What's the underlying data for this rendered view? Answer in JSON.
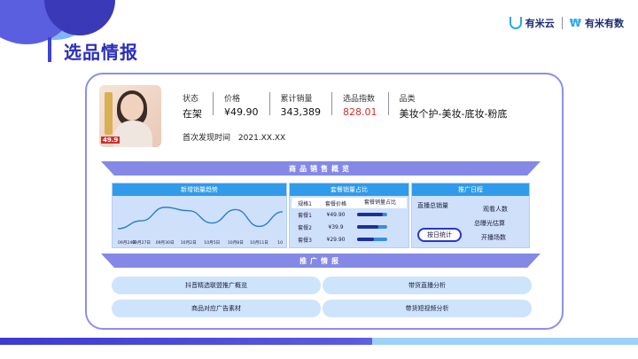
{
  "brand": {
    "logo_left": "有米云",
    "logo_right": "有米有数"
  },
  "page_title": "选品情报",
  "product": {
    "price_tag": "49.9",
    "fields": [
      {
        "label": "状态",
        "value": "在架"
      },
      {
        "label": "价格",
        "value": "¥49.90"
      },
      {
        "label": "累计销量",
        "value": "343,389"
      },
      {
        "label": "选品指数",
        "value": "828.01"
      },
      {
        "label": "品类",
        "value": "美妆个护-美妆-底妆-粉底"
      }
    ],
    "first_seen_label": "首次发现时间",
    "first_seen_value": "2021.XX.XX"
  },
  "sales_overview": {
    "ribbon": "商品销售概览",
    "trend_title": "新增销量趋势",
    "package_title": "套餐销量占比",
    "schedule_title": "推广日程",
    "package_headers": [
      "规格1",
      "套餐价格",
      "套餐销量占比"
    ],
    "packages": [
      {
        "name": "套餐1",
        "price": "¥49.90",
        "share": 0.85
      },
      {
        "name": "套餐2",
        "price": "¥39.9",
        "share": 0.7
      },
      {
        "name": "套餐3",
        "price": "¥29.90",
        "share": 0.55
      }
    ],
    "schedule_items": [
      "直播总销量",
      "观看人数",
      "总曝光估算",
      "开播场数"
    ],
    "schedule_button": "按日统计"
  },
  "chart_data": {
    "type": "line",
    "x": [
      "09月24日",
      "09月27日",
      "09月30日",
      "10月2日",
      "10月5日",
      "10月8日",
      "10月11日",
      "10"
    ],
    "values": [
      8,
      22,
      46,
      40,
      18,
      42,
      12,
      38
    ],
    "ylim": [
      0,
      60
    ]
  },
  "promotion": {
    "ribbon": "推广情报",
    "items": [
      "抖音精选联盟推广概览",
      "带货直播分析",
      "商品对应广告素材",
      "带货短视频分析"
    ]
  },
  "colors": {
    "accent": "#2a2fb8",
    "panel": "#cfe0fb",
    "panel_head": "#2f9bea",
    "ribbon": "#8489e6",
    "price_index": "#c83030"
  }
}
